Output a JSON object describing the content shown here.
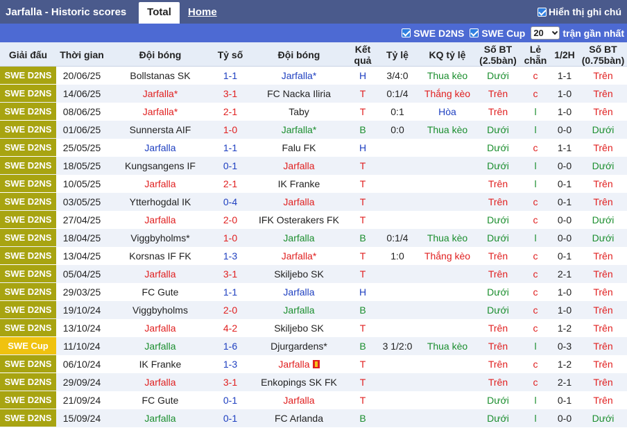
{
  "topbar": {
    "title": "Jarfalla - Historic scores",
    "tab_total": "Total",
    "tab_home": "Home",
    "show_all_label": "Hiển thị ghi chú"
  },
  "filters": {
    "league1": "SWE D2NS",
    "league2": "SWE Cup",
    "count": "20",
    "recent_label": "trận gần nhất"
  },
  "headers": {
    "league": "Giải đấu",
    "time": "Thời gian",
    "home_team": "Đội bóng",
    "score": "Tỷ số",
    "away_team": "Đội bóng",
    "result": "Kết quả",
    "odds": "Tỷ lệ",
    "odds_result": "KQ tỷ lệ",
    "goals25": "Số BT (2.5bàn)",
    "odd_even": "Lẻ chẵn",
    "half": "1/2H",
    "goals075": "Số BT (0.75bàn)"
  },
  "colors": {
    "topbar": "#4a5a8c",
    "filterbar": "#4d6ad3",
    "league_d2ns": "#a8a411",
    "league_cup": "#f0c20f",
    "red": "#e02020",
    "blue": "#1e3fc0",
    "green": "#1b8e2e"
  },
  "rows": [
    {
      "league": "SWE D2NS",
      "cup": false,
      "date": "20/06/25",
      "home": "Bollstanas SK",
      "home_c": "gray",
      "score": "1-1",
      "score_c": "blue",
      "away": "Jarfalla*",
      "away_c": "blue",
      "res": "H",
      "res_c": "blue",
      "odds": "3/4:0",
      "kq": "Thua kèo",
      "kq_c": "green",
      "g25": "Dưới",
      "g25_c": "green",
      "oe": "c",
      "oe_c": "red",
      "half": "1-1",
      "g075": "Trên",
      "g075_c": "red",
      "flag": false
    },
    {
      "league": "SWE D2NS",
      "cup": false,
      "date": "14/06/25",
      "home": "Jarfalla*",
      "home_c": "red",
      "score": "3-1",
      "score_c": "red",
      "away": "FC Nacka Iliria",
      "away_c": "gray",
      "res": "T",
      "res_c": "red",
      "odds": "0:1/4",
      "kq": "Thắng kèo",
      "kq_c": "red",
      "g25": "Trên",
      "g25_c": "red",
      "oe": "c",
      "oe_c": "red",
      "half": "1-0",
      "g075": "Trên",
      "g075_c": "red",
      "flag": false
    },
    {
      "league": "SWE D2NS",
      "cup": false,
      "date": "08/06/25",
      "home": "Jarfalla*",
      "home_c": "red",
      "score": "2-1",
      "score_c": "red",
      "away": "Taby",
      "away_c": "gray",
      "res": "T",
      "res_c": "red",
      "odds": "0:1",
      "kq": "Hòa",
      "kq_c": "blue",
      "g25": "Trên",
      "g25_c": "red",
      "oe": "l",
      "oe_c": "green",
      "half": "1-0",
      "g075": "Trên",
      "g075_c": "red",
      "flag": false
    },
    {
      "league": "SWE D2NS",
      "cup": false,
      "date": "01/06/25",
      "home": "Sunnersta AIF",
      "home_c": "gray",
      "score": "1-0",
      "score_c": "red",
      "away": "Jarfalla*",
      "away_c": "green",
      "res": "B",
      "res_c": "green",
      "odds": "0:0",
      "kq": "Thua kèo",
      "kq_c": "green",
      "g25": "Dưới",
      "g25_c": "green",
      "oe": "l",
      "oe_c": "green",
      "half": "0-0",
      "g075": "Dưới",
      "g075_c": "green",
      "flag": false
    },
    {
      "league": "SWE D2NS",
      "cup": false,
      "date": "25/05/25",
      "home": "Jarfalla",
      "home_c": "blue",
      "score": "1-1",
      "score_c": "blue",
      "away": "Falu FK",
      "away_c": "gray",
      "res": "H",
      "res_c": "blue",
      "odds": "",
      "kq": "",
      "kq_c": "gray",
      "g25": "Dưới",
      "g25_c": "green",
      "oe": "c",
      "oe_c": "red",
      "half": "1-1",
      "g075": "Trên",
      "g075_c": "red",
      "flag": false
    },
    {
      "league": "SWE D2NS",
      "cup": false,
      "date": "18/05/25",
      "home": "Kungsangens IF",
      "home_c": "gray",
      "score": "0-1",
      "score_c": "blue",
      "away": "Jarfalla",
      "away_c": "red",
      "res": "T",
      "res_c": "red",
      "odds": "",
      "kq": "",
      "kq_c": "gray",
      "g25": "Dưới",
      "g25_c": "green",
      "oe": "l",
      "oe_c": "green",
      "half": "0-0",
      "g075": "Dưới",
      "g075_c": "green",
      "flag": false
    },
    {
      "league": "SWE D2NS",
      "cup": false,
      "date": "10/05/25",
      "home": "Jarfalla",
      "home_c": "red",
      "score": "2-1",
      "score_c": "red",
      "away": "IK Franke",
      "away_c": "gray",
      "res": "T",
      "res_c": "red",
      "odds": "",
      "kq": "",
      "kq_c": "gray",
      "g25": "Trên",
      "g25_c": "red",
      "oe": "l",
      "oe_c": "green",
      "half": "0-1",
      "g075": "Trên",
      "g075_c": "red",
      "flag": false
    },
    {
      "league": "SWE D2NS",
      "cup": false,
      "date": "03/05/25",
      "home": "Ytterhogdal IK",
      "home_c": "gray",
      "score": "0-4",
      "score_c": "blue",
      "away": "Jarfalla",
      "away_c": "red",
      "res": "T",
      "res_c": "red",
      "odds": "",
      "kq": "",
      "kq_c": "gray",
      "g25": "Trên",
      "g25_c": "red",
      "oe": "c",
      "oe_c": "red",
      "half": "0-1",
      "g075": "Trên",
      "g075_c": "red",
      "flag": false
    },
    {
      "league": "SWE D2NS",
      "cup": false,
      "date": "27/04/25",
      "home": "Jarfalla",
      "home_c": "red",
      "score": "2-0",
      "score_c": "red",
      "away": "IFK Osterakers FK",
      "away_c": "gray",
      "res": "T",
      "res_c": "red",
      "odds": "",
      "kq": "",
      "kq_c": "gray",
      "g25": "Dưới",
      "g25_c": "green",
      "oe": "c",
      "oe_c": "red",
      "half": "0-0",
      "g075": "Dưới",
      "g075_c": "green",
      "flag": false
    },
    {
      "league": "SWE D2NS",
      "cup": false,
      "date": "18/04/25",
      "home": "Viggbyholms*",
      "home_c": "gray",
      "score": "1-0",
      "score_c": "red",
      "away": "Jarfalla",
      "away_c": "green",
      "res": "B",
      "res_c": "green",
      "odds": "0:1/4",
      "kq": "Thua kèo",
      "kq_c": "green",
      "g25": "Dưới",
      "g25_c": "green",
      "oe": "l",
      "oe_c": "green",
      "half": "0-0",
      "g075": "Dưới",
      "g075_c": "green",
      "flag": false
    },
    {
      "league": "SWE D2NS",
      "cup": false,
      "date": "13/04/25",
      "home": "Korsnas IF FK",
      "home_c": "gray",
      "score": "1-3",
      "score_c": "blue",
      "away": "Jarfalla*",
      "away_c": "red",
      "res": "T",
      "res_c": "red",
      "odds": "1:0",
      "kq": "Thắng kèo",
      "kq_c": "red",
      "g25": "Trên",
      "g25_c": "red",
      "oe": "c",
      "oe_c": "red",
      "half": "0-1",
      "g075": "Trên",
      "g075_c": "red",
      "flag": false
    },
    {
      "league": "SWE D2NS",
      "cup": false,
      "date": "05/04/25",
      "home": "Jarfalla",
      "home_c": "red",
      "score": "3-1",
      "score_c": "red",
      "away": "Skiljebo SK",
      "away_c": "gray",
      "res": "T",
      "res_c": "red",
      "odds": "",
      "kq": "",
      "kq_c": "gray",
      "g25": "Trên",
      "g25_c": "red",
      "oe": "c",
      "oe_c": "red",
      "half": "2-1",
      "g075": "Trên",
      "g075_c": "red",
      "flag": false
    },
    {
      "league": "SWE D2NS",
      "cup": false,
      "date": "29/03/25",
      "home": "FC Gute",
      "home_c": "gray",
      "score": "1-1",
      "score_c": "blue",
      "away": "Jarfalla",
      "away_c": "blue",
      "res": "H",
      "res_c": "blue",
      "odds": "",
      "kq": "",
      "kq_c": "gray",
      "g25": "Dưới",
      "g25_c": "green",
      "oe": "c",
      "oe_c": "red",
      "half": "1-0",
      "g075": "Trên",
      "g075_c": "red",
      "flag": false
    },
    {
      "league": "SWE D2NS",
      "cup": false,
      "date": "19/10/24",
      "home": "Viggbyholms",
      "home_c": "gray",
      "score": "2-0",
      "score_c": "red",
      "away": "Jarfalla",
      "away_c": "green",
      "res": "B",
      "res_c": "green",
      "odds": "",
      "kq": "",
      "kq_c": "gray",
      "g25": "Dưới",
      "g25_c": "green",
      "oe": "c",
      "oe_c": "red",
      "half": "1-0",
      "g075": "Trên",
      "g075_c": "red",
      "flag": false
    },
    {
      "league": "SWE D2NS",
      "cup": false,
      "date": "13/10/24",
      "home": "Jarfalla",
      "home_c": "red",
      "score": "4-2",
      "score_c": "red",
      "away": "Skiljebo SK",
      "away_c": "gray",
      "res": "T",
      "res_c": "red",
      "odds": "",
      "kq": "",
      "kq_c": "gray",
      "g25": "Trên",
      "g25_c": "red",
      "oe": "c",
      "oe_c": "red",
      "half": "1-2",
      "g075": "Trên",
      "g075_c": "red",
      "flag": false
    },
    {
      "league": "SWE Cup",
      "cup": true,
      "date": "11/10/24",
      "home": "Jarfalla",
      "home_c": "green",
      "score": "1-6",
      "score_c": "blue",
      "away": "Djurgardens*",
      "away_c": "gray",
      "res": "B",
      "res_c": "green",
      "odds": "3 1/2:0",
      "kq": "Thua kèo",
      "kq_c": "green",
      "g25": "Trên",
      "g25_c": "red",
      "oe": "l",
      "oe_c": "green",
      "half": "0-3",
      "g075": "Trên",
      "g075_c": "red",
      "flag": false
    },
    {
      "league": "SWE D2NS",
      "cup": false,
      "date": "06/10/24",
      "home": "IK Franke",
      "home_c": "gray",
      "score": "1-3",
      "score_c": "blue",
      "away": "Jarfalla",
      "away_c": "red",
      "res": "T",
      "res_c": "red",
      "odds": "",
      "kq": "",
      "kq_c": "gray",
      "g25": "Trên",
      "g25_c": "red",
      "oe": "c",
      "oe_c": "red",
      "half": "1-2",
      "g075": "Trên",
      "g075_c": "red",
      "flag": true
    },
    {
      "league": "SWE D2NS",
      "cup": false,
      "date": "29/09/24",
      "home": "Jarfalla",
      "home_c": "red",
      "score": "3-1",
      "score_c": "red",
      "away": "Enkopings SK FK",
      "away_c": "gray",
      "res": "T",
      "res_c": "red",
      "odds": "",
      "kq": "",
      "kq_c": "gray",
      "g25": "Trên",
      "g25_c": "red",
      "oe": "c",
      "oe_c": "red",
      "half": "2-1",
      "g075": "Trên",
      "g075_c": "red",
      "flag": false
    },
    {
      "league": "SWE D2NS",
      "cup": false,
      "date": "21/09/24",
      "home": "FC Gute",
      "home_c": "gray",
      "score": "0-1",
      "score_c": "blue",
      "away": "Jarfalla",
      "away_c": "red",
      "res": "T",
      "res_c": "red",
      "odds": "",
      "kq": "",
      "kq_c": "gray",
      "g25": "Dưới",
      "g25_c": "green",
      "oe": "l",
      "oe_c": "green",
      "half": "0-1",
      "g075": "Trên",
      "g075_c": "red",
      "flag": false
    },
    {
      "league": "SWE D2NS",
      "cup": false,
      "date": "15/09/24",
      "home": "Jarfalla",
      "home_c": "green",
      "score": "0-1",
      "score_c": "blue",
      "away": "FC Arlanda",
      "away_c": "gray",
      "res": "B",
      "res_c": "green",
      "odds": "",
      "kq": "",
      "kq_c": "gray",
      "g25": "Dưới",
      "g25_c": "green",
      "oe": "l",
      "oe_c": "green",
      "half": "0-0",
      "g075": "Dưới",
      "g075_c": "green",
      "flag": false
    }
  ]
}
